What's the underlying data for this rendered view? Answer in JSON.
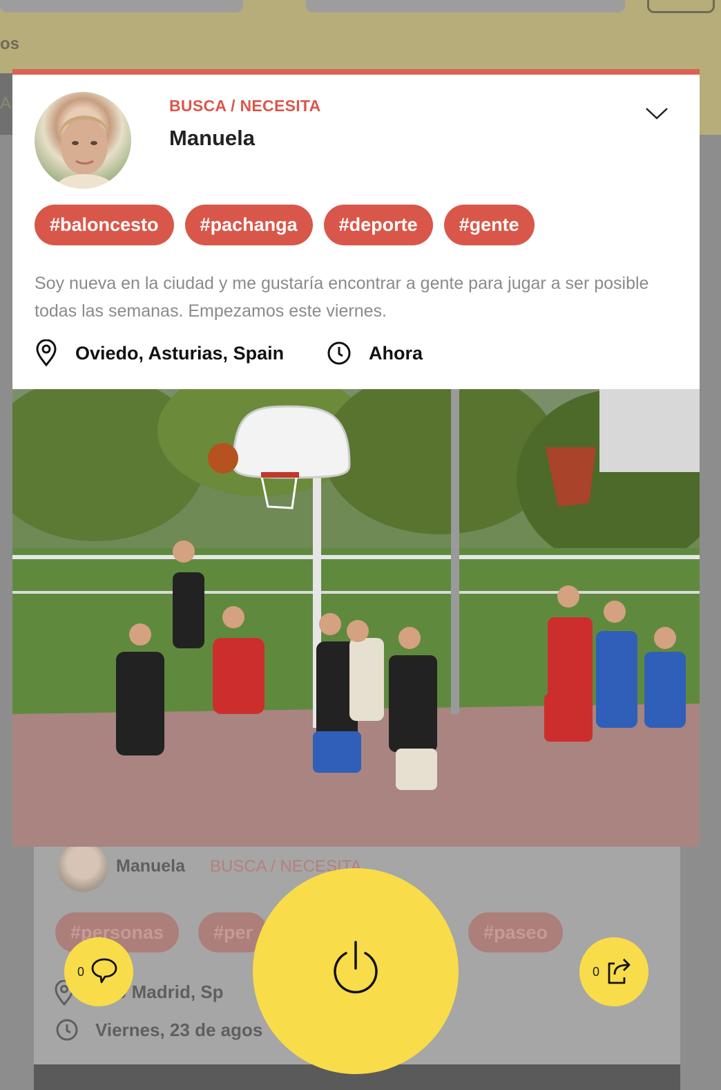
{
  "background": {
    "nav_fragment": "os",
    "tab_fragment": "AD",
    "card": {
      "name": "Manuela",
      "role": "BUSCA / NECESITA",
      "tags": [
        "#personas",
        "#per",
        "#paseo"
      ],
      "location": "040 Madrid, Sp",
      "date": "Viernes, 23 de agos"
    }
  },
  "post": {
    "role": "BUSCA / NECESITA",
    "name": "Manuela",
    "tags": [
      "#baloncesto",
      "#pachanga",
      "#deporte",
      "#gente"
    ],
    "description": "Soy nueva en la ciudad y me gustaría encontrar a gente para jugar a ser posible todas las semanas. Empezamos este viernes.",
    "location": "Oviedo, Asturias, Spain",
    "time": "Ahora"
  },
  "actions": {
    "comment_count": "0",
    "share_count": "0"
  },
  "icons": {
    "expand": "chevron-down-icon",
    "location": "location-pin-icon",
    "time": "clock-icon",
    "power": "power-icon",
    "comment": "speech-bubble-icon",
    "share": "share-arrow-icon"
  },
  "colors": {
    "accent": "#d9574a",
    "fab": "#f8dc4a",
    "background_header": "#b6ad7a"
  }
}
